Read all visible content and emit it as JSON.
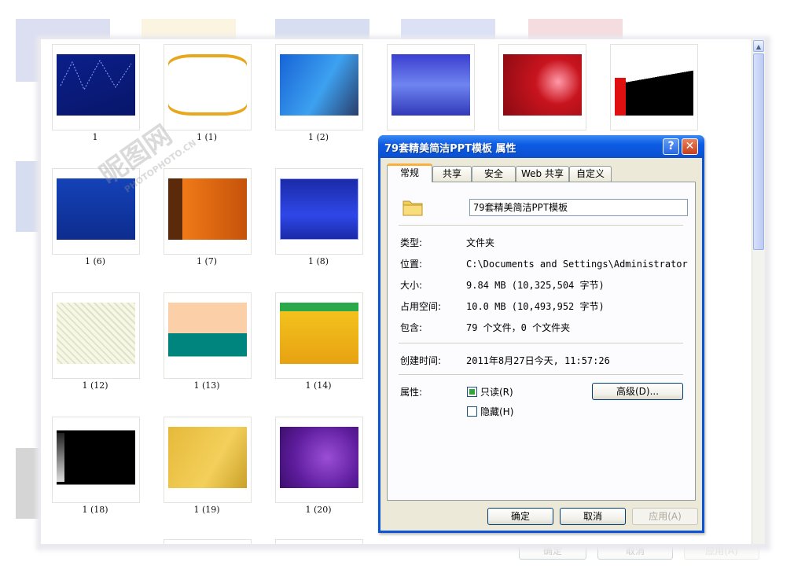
{
  "thumbnails": [
    {
      "caption": "1"
    },
    {
      "caption": "1 (1)"
    },
    {
      "caption": "1 (2)"
    },
    {
      "caption": ""
    },
    {
      "caption": ""
    },
    {
      "caption": ""
    },
    {
      "caption": "1 (6)"
    },
    {
      "caption": "1 (7)"
    },
    {
      "caption": "1 (8)"
    },
    {
      "caption": "1 (12)"
    },
    {
      "caption": "1 (13)"
    },
    {
      "caption": "1 (14)"
    },
    {
      "caption": "1 (18)"
    },
    {
      "caption": "1 (19)"
    },
    {
      "caption": "1 (20)"
    }
  ],
  "dialog": {
    "title": "79套精美简洁PPT模板 属性",
    "help_symbol": "?",
    "close_symbol": "✕",
    "tabs": [
      "常规",
      "共享",
      "安全",
      "Web 共享",
      "自定义"
    ],
    "active_tab": "常规",
    "folder_icon": "folder-icon",
    "name_value": "79套精美简洁PPT模板",
    "type_label": "类型:",
    "type_value": "文件夹",
    "location_label": "位置:",
    "location_value": "C:\\Documents and Settings\\Administrator\\桌",
    "size_label": "大小:",
    "size_value": "9.84 MB (10,325,504 字节)",
    "disk_size_label": "占用空间:",
    "disk_size_value": "10.0 MB (10,493,952 字节)",
    "contains_label": "包含:",
    "contains_value": "79 个文件，0 个文件夹",
    "created_label": "创建时间:",
    "created_value": "2011年8月27日今天, 11:57:26",
    "attributes_label": "属性:",
    "readonly_label": "只读(R)",
    "readonly_checked": true,
    "hidden_label": "隐藏(H)",
    "hidden_checked": false,
    "advanced_button": "高级(D)...",
    "ok_button": "确定",
    "cancel_button": "取消",
    "apply_button": "应用(A)"
  },
  "background_ghost": {
    "ok_button": "确定",
    "cancel_button": "取消",
    "apply_button": "应用(A)"
  },
  "watermark": {
    "brand": "昵图网",
    "site": "PHOTOPHOTO.CN"
  },
  "colors": {
    "title_bar": "#0b54d6",
    "dialog_face": "#ece9d8",
    "active_tab_accent": "#f8b23c"
  }
}
